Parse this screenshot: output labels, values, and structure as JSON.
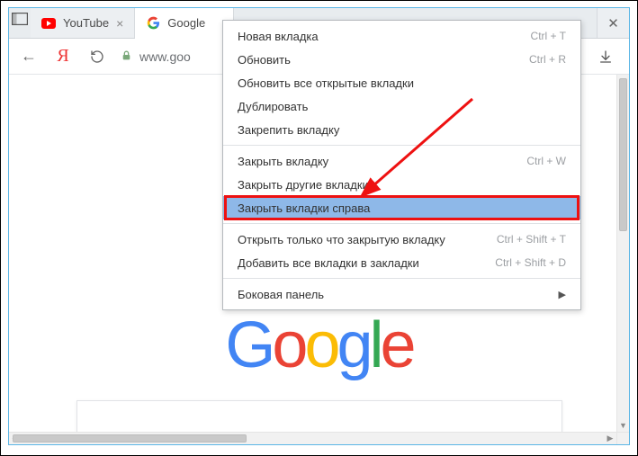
{
  "tabs": [
    {
      "label": "YouTube"
    },
    {
      "label": "Google"
    }
  ],
  "address": {
    "host_prefix": "www.goo"
  },
  "logo_letters": [
    "G",
    "o",
    "o",
    "g",
    "l",
    "e"
  ],
  "context_menu": {
    "items": [
      {
        "label": "Новая вкладка",
        "shortcut": "Ctrl + T"
      },
      {
        "label": "Обновить",
        "shortcut": "Ctrl + R"
      },
      {
        "label": "Обновить все открытые вкладки"
      },
      {
        "label": "Дублировать"
      },
      {
        "label": "Закрепить вкладку"
      },
      {
        "sep": true
      },
      {
        "label": "Закрыть вкладку",
        "shortcut": "Ctrl + W"
      },
      {
        "label": "Закрыть другие вкладки"
      },
      {
        "label": "Закрыть вкладки справа",
        "highlight": true,
        "boxed": true
      },
      {
        "sep": true
      },
      {
        "label": "Открыть только что закрытую вкладку",
        "shortcut": "Ctrl + Shift + T"
      },
      {
        "label": "Добавить все вкладки в закладки",
        "shortcut": "Ctrl + Shift + D"
      },
      {
        "sep": true
      },
      {
        "label": "Боковая панель",
        "submenu": true
      }
    ]
  }
}
